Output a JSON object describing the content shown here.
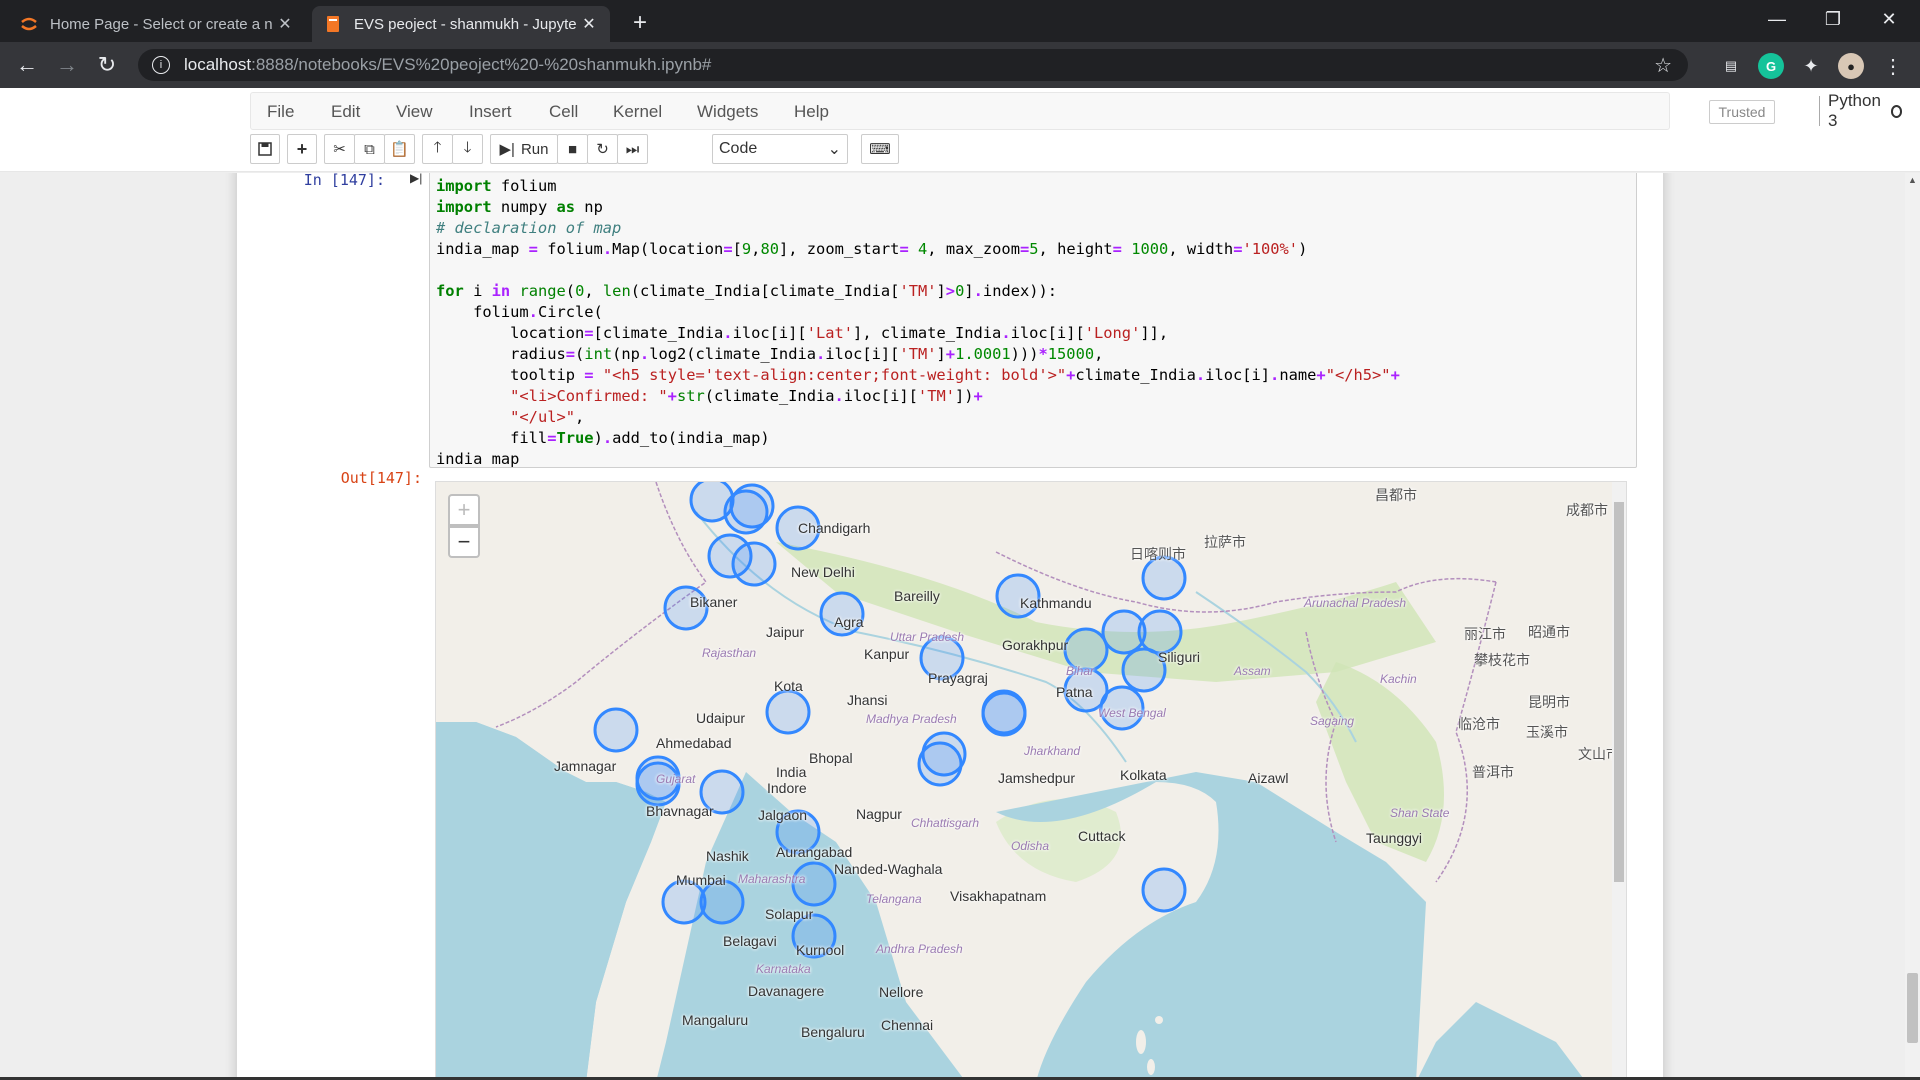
{
  "browser": {
    "tabs": [
      {
        "title": "Home Page - Select or create a n",
        "icon": "jupyter-logo-icon",
        "active": false
      },
      {
        "title": "EVS peoject - shanmukh - Jupyte",
        "icon": "notebook-icon",
        "active": true
      }
    ],
    "url_host": "localhost",
    "url_path": ":8888/notebooks/EVS%20peoject%20-%20shanmukh.ipynb#"
  },
  "jupyter": {
    "menus": [
      "File",
      "Edit",
      "View",
      "Insert",
      "Cell",
      "Kernel",
      "Widgets",
      "Help"
    ],
    "trusted": "Trusted",
    "kernel_name": "Python 3",
    "run_label": "Run",
    "cell_type": "Code"
  },
  "cell": {
    "in_prompt": "In [147]:",
    "out_prompt": "Out[147]:"
  },
  "map": {
    "zoom_in": "+",
    "zoom_out": "−",
    "labels": [
      {
        "text": "New Delhi"
      },
      {
        "text": "Bikaner"
      },
      {
        "text": "Jaipur"
      },
      {
        "text": "Agra"
      },
      {
        "text": "Bareilly"
      },
      {
        "text": "Kathmandu"
      },
      {
        "text": "Gorakhpur"
      },
      {
        "text": "Kanpur"
      },
      {
        "text": "Prayagraj"
      },
      {
        "text": "Siliguri"
      },
      {
        "text": "Patna"
      },
      {
        "text": "Kota"
      },
      {
        "text": "Jhansi"
      },
      {
        "text": "Udaipur"
      },
      {
        "text": "Ahmedabad"
      },
      {
        "text": "Bhopal"
      },
      {
        "text": "Indore"
      },
      {
        "text": "Jamnagar"
      },
      {
        "text": "Bhavnagar"
      },
      {
        "text": "Jalgaon"
      },
      {
        "text": "Nagpur"
      },
      {
        "text": "Jamshedpur"
      },
      {
        "text": "Kolkata"
      },
      {
        "text": "Cuttack"
      },
      {
        "text": "Aurangabad"
      },
      {
        "text": "Nashik"
      },
      {
        "text": "Mumbai"
      },
      {
        "text": "Nanded-Waghala"
      },
      {
        "text": "Visakhapatnam"
      },
      {
        "text": "Solapur"
      },
      {
        "text": "Belagavi"
      },
      {
        "text": "Kurnool"
      },
      {
        "text": "Davanagere"
      },
      {
        "text": "Nellore"
      },
      {
        "text": "Mangaluru"
      },
      {
        "text": "Bengaluru"
      },
      {
        "text": "Chennai"
      },
      {
        "text": "Chandigarh"
      },
      {
        "text": "Aizawl"
      },
      {
        "text": "Taunggyi"
      },
      {
        "text": "昌都市"
      },
      {
        "text": "成都市"
      },
      {
        "text": "拉萨市"
      },
      {
        "text": "日喀则市"
      },
      {
        "text": "丽江市"
      },
      {
        "text": "昭通市"
      },
      {
        "text": "攀枝花市"
      },
      {
        "text": "昆明市"
      },
      {
        "text": "临沧市"
      },
      {
        "text": "玉溪市"
      },
      {
        "text": "普洱市"
      },
      {
        "text": "文山市"
      },
      {
        "text": "Shan State"
      },
      {
        "text": "India"
      }
    ],
    "state_labels": [
      "Uttar Pradesh",
      "Bihar",
      "West Bengal",
      "Rajasthan",
      "Madhya Pradesh",
      "Gujarat",
      "Jharkhand",
      "Chhattisgarh",
      "Odisha",
      "Maharashtra",
      "Telangana",
      "Andhra Pradesh",
      "Karnataka",
      "Arunachal Pradesh",
      "Assam",
      "Sagaing",
      "Kachin"
    ],
    "circle_color": "#3388ff"
  }
}
